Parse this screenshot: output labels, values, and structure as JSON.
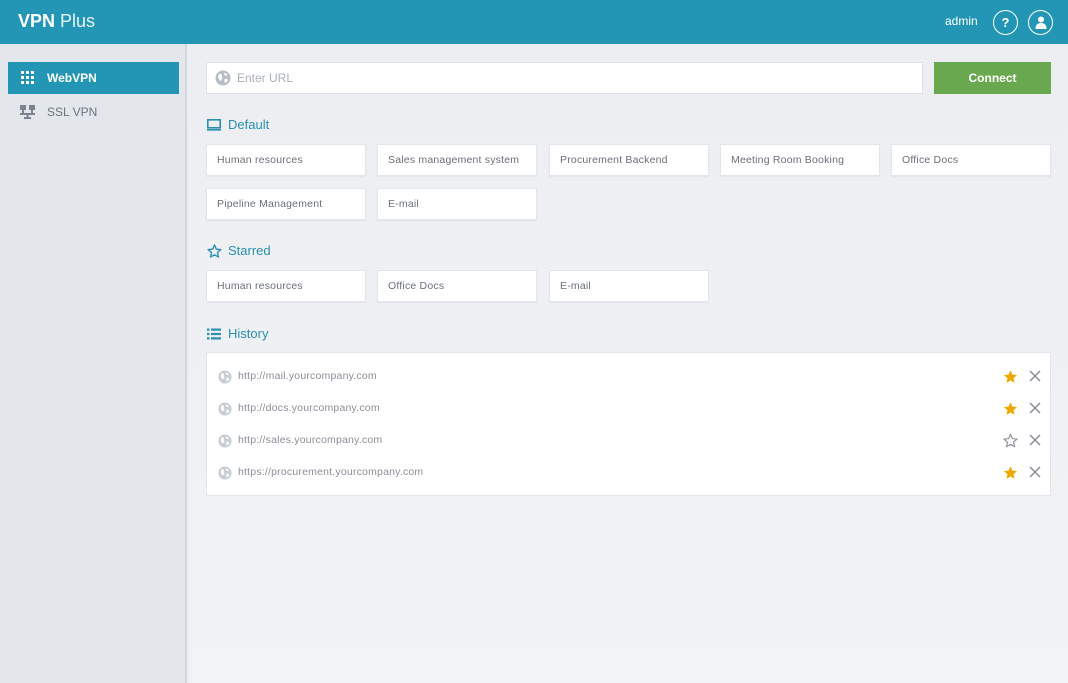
{
  "header": {
    "brand_bold": "VPN",
    "brand_light": "Plus",
    "user": "admin",
    "help_label": "?"
  },
  "sidebar": {
    "items": [
      {
        "label": "WebVPN",
        "icon": "grid-icon",
        "active": true
      },
      {
        "label": "SSL VPN",
        "icon": "network-icon",
        "active": false
      }
    ]
  },
  "search": {
    "placeholder": "Enter URL",
    "value": "",
    "connect_label": "Connect"
  },
  "sections": {
    "default_title": "Default",
    "starred_title": "Starred",
    "history_title": "History"
  },
  "default_apps": [
    "Human resources",
    "Sales management system",
    "Procurement Backend",
    "Meeting Room Booking",
    "Office Docs",
    "Pipeline Management",
    "E-mail"
  ],
  "starred_apps": [
    "Human resources",
    "Office Docs",
    "E-mail"
  ],
  "history": [
    {
      "url": "http://mail.yourcompany.com",
      "starred": true
    },
    {
      "url": "http://docs.yourcompany.com",
      "starred": true
    },
    {
      "url": "http://sales.yourcompany.com",
      "starred": false
    },
    {
      "url": "https://procurement.yourcompany.com",
      "starred": true
    }
  ],
  "colors": {
    "accent": "#2496b5",
    "connect": "#6aa84f",
    "star": "#f0a800"
  }
}
